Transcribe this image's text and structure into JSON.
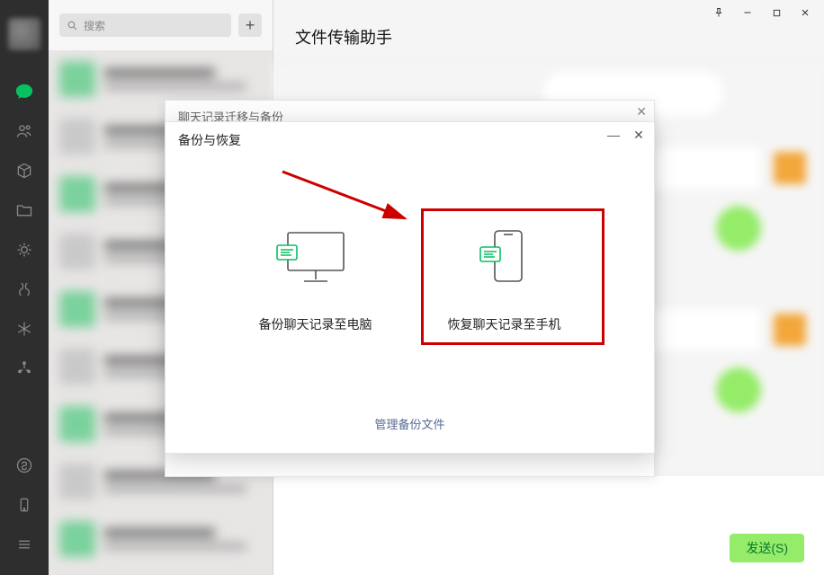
{
  "search": {
    "placeholder": "搜索"
  },
  "chat_header": {
    "title": "文件传输助手"
  },
  "send_button_label": "发送(S)",
  "back_dialog": {
    "title": "聊天记录迁移与备份"
  },
  "dialog": {
    "title": "备份与恢复",
    "option_backup": "备份聊天记录至电脑",
    "option_restore": "恢复聊天记录至手机",
    "manage_link": "管理备份文件"
  },
  "nav_icons": [
    {
      "name": "chat-icon",
      "active": true
    },
    {
      "name": "contacts-icon"
    },
    {
      "name": "packages-icon"
    },
    {
      "name": "folder-icon"
    },
    {
      "name": "moments-icon"
    },
    {
      "name": "channels-icon"
    },
    {
      "name": "snowflake-icon"
    },
    {
      "name": "discover-icon"
    }
  ],
  "nav_bottom_icons": [
    {
      "name": "miniprogram-icon"
    },
    {
      "name": "phone-icon"
    },
    {
      "name": "menu-icon"
    }
  ],
  "window_buttons": [
    "pin",
    "minimize",
    "maximize",
    "close"
  ]
}
